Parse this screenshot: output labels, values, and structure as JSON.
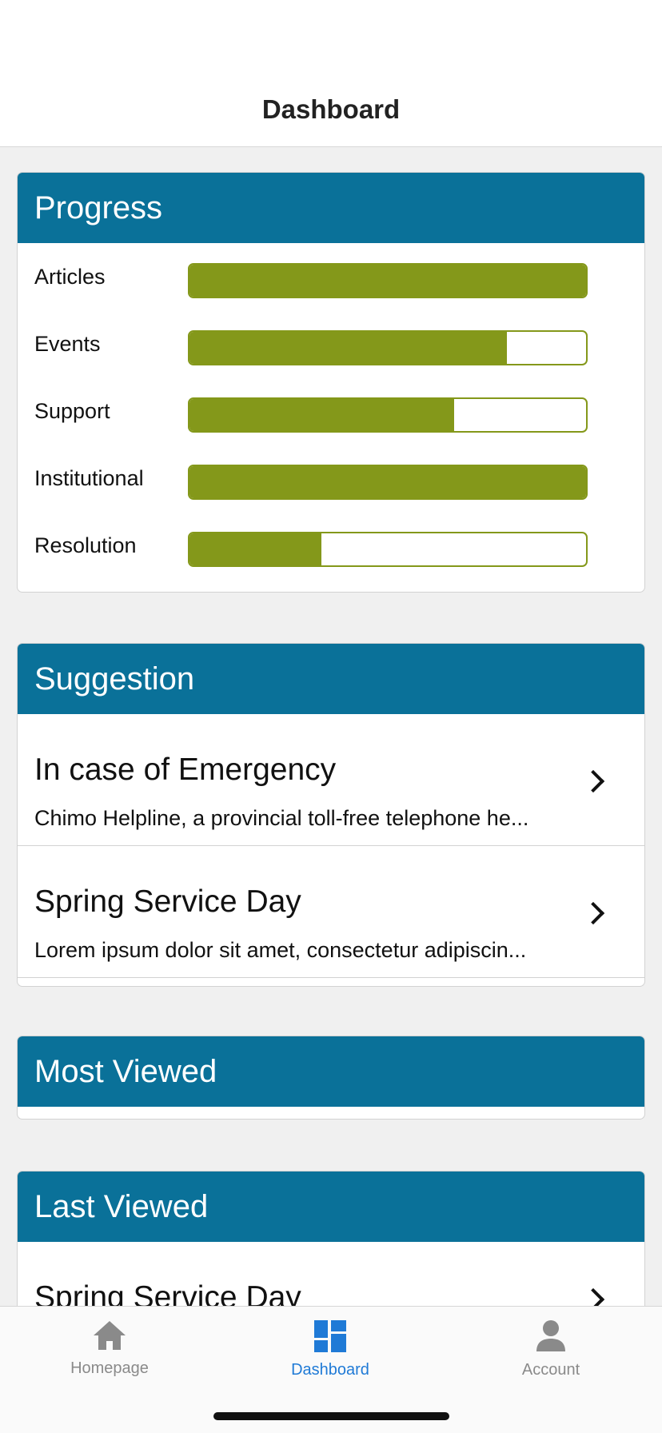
{
  "navbar": {
    "title": "Dashboard"
  },
  "progress": {
    "header": "Progress",
    "rows": [
      {
        "label": "Articles",
        "level": 1.0
      },
      {
        "label": "Events",
        "level": 0.8
      },
      {
        "label": "Support",
        "level": 0.667
      },
      {
        "label": "Institutional",
        "level": 1.0
      },
      {
        "label": "Resolution",
        "level": 0.333
      }
    ]
  },
  "suggestion": {
    "header": "Suggestion",
    "items": [
      {
        "title": "In case of Emergency",
        "subtitle": "Chimo Helpline, a provincial toll-free telephone he..."
      },
      {
        "title": "Spring Service Day",
        "subtitle": "Lorem ipsum dolor sit amet, consectetur adipiscin..."
      }
    ]
  },
  "most_viewed": {
    "header": "Most Viewed"
  },
  "last_viewed": {
    "header": "Last Viewed",
    "items": [
      {
        "title": "Spring Service Day"
      }
    ]
  },
  "tabbar": {
    "tabs": [
      {
        "label": "Homepage",
        "icon": "home-icon",
        "active": false
      },
      {
        "label": "Dashboard",
        "icon": "dashboard-icon",
        "active": true
      },
      {
        "label": "Account",
        "icon": "person-icon",
        "active": false
      }
    ]
  },
  "colors": {
    "header_bg": "#0a7199",
    "progress_fill": "#84981a",
    "tab_active": "#1f7ad6",
    "tab_inactive": "#8a8a8a"
  }
}
